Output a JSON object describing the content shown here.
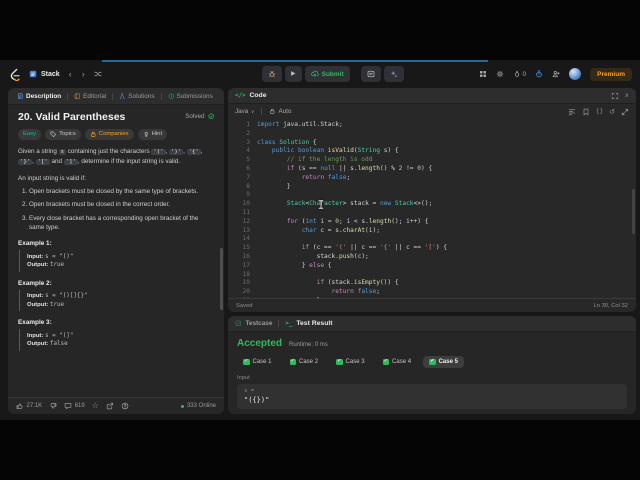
{
  "navbar": {
    "problem_list_label": "Stack",
    "submit_label": "Submit",
    "streak_count": "0",
    "premium_label": "Premium"
  },
  "description_panel": {
    "tabs": [
      {
        "label": "Description",
        "icon": "description",
        "active": true
      },
      {
        "label": "Editorial",
        "icon": "editorial",
        "active": false
      },
      {
        "label": "Solutions",
        "icon": "solutions",
        "active": false
      },
      {
        "label": "Submissions",
        "icon": "submissions",
        "active": false
      }
    ],
    "title": "20. Valid Parentheses",
    "solved_label": "Solved",
    "difficulty": "Easy",
    "topics_label": "Topics",
    "companies_label": "Companies",
    "hint_label": "Hint",
    "intro_segments": [
      {
        "t": "Given a string "
      },
      {
        "c": "s"
      },
      {
        "t": " containing just the characters "
      },
      {
        "c": "'('"
      },
      {
        "t": ", "
      },
      {
        "c": "')'"
      },
      {
        "t": ", "
      },
      {
        "c": "'{'"
      },
      {
        "t": ", "
      },
      {
        "c": "'}'"
      },
      {
        "t": ", "
      },
      {
        "c": "'['"
      },
      {
        "t": " and "
      },
      {
        "c": "']'"
      },
      {
        "t": ", determine if the input string is valid."
      }
    ],
    "valid_intro": "An input string is valid if:",
    "rules": [
      "Open brackets must be closed by the same type of brackets.",
      "Open brackets must be closed in the correct order.",
      "Every close bracket has a corresponding open bracket of the same type."
    ],
    "examples": [
      {
        "label": "Example 1:",
        "input_label": "Input:",
        "input_value": "s = \"()\"",
        "output_label": "Output:",
        "output_value": "true"
      },
      {
        "label": "Example 2:",
        "input_label": "Input:",
        "input_value": "s = \"()[]{}\"",
        "output_label": "Output:",
        "output_value": "true"
      },
      {
        "label": "Example 3:",
        "input_label": "Input:",
        "input_value": "s = \"(]\"",
        "output_label": "Output:",
        "output_value": "false"
      }
    ],
    "footer": {
      "likes": "27.1K",
      "comments": "619",
      "online_label": "333 Online"
    }
  },
  "code_panel": {
    "header_label": "Code",
    "language": "Java",
    "auto_label": "Auto",
    "status_saved": "Saved",
    "cursor_position": "Ln 30, Col 32",
    "code_lines": [
      [
        [
          "kw",
          "import"
        ],
        [
          "pl",
          " java.util.Stack;"
        ]
      ],
      [],
      [
        [
          "kw",
          "class"
        ],
        [
          "pl",
          " "
        ],
        [
          "ty",
          "Solution"
        ],
        [
          "pl",
          " {"
        ]
      ],
      [
        [
          "pl",
          "    "
        ],
        [
          "kw",
          "public boolean"
        ],
        [
          "pl",
          " "
        ],
        [
          "fn",
          "isValid"
        ],
        [
          "pl",
          "("
        ],
        [
          "ty",
          "String"
        ],
        [
          "pl",
          " s) {"
        ]
      ],
      [
        [
          "cm",
          "        // if the length is odd"
        ]
      ],
      [
        [
          "pl",
          "        "
        ],
        [
          "ct",
          "if"
        ],
        [
          "pl",
          " (s == "
        ],
        [
          "kw",
          "null"
        ],
        [
          "pl",
          " || s."
        ],
        [
          "fn",
          "length"
        ],
        [
          "pl",
          "() % "
        ],
        [
          "nu",
          "2"
        ],
        [
          "pl",
          " != "
        ],
        [
          "nu",
          "0"
        ],
        [
          "pl",
          ") {"
        ]
      ],
      [
        [
          "pl",
          "            "
        ],
        [
          "ct",
          "return"
        ],
        [
          "pl",
          " "
        ],
        [
          "kw",
          "false"
        ],
        [
          "pl",
          ";"
        ]
      ],
      [
        [
          "pl",
          "        }"
        ]
      ],
      [],
      [
        [
          "pl",
          "        "
        ],
        [
          "ty",
          "Stack"
        ],
        [
          "pl",
          "<"
        ],
        [
          "ty",
          "Character"
        ],
        [
          "pl",
          "> stack = "
        ],
        [
          "kw",
          "new"
        ],
        [
          "pl",
          " "
        ],
        [
          "ty",
          "Stack"
        ],
        [
          "pl",
          "<>();"
        ]
      ],
      [],
      [
        [
          "pl",
          "        "
        ],
        [
          "ct",
          "for"
        ],
        [
          "pl",
          " ("
        ],
        [
          "kw",
          "int"
        ],
        [
          "pl",
          " i = "
        ],
        [
          "nu",
          "0"
        ],
        [
          "pl",
          "; i < s."
        ],
        [
          "fn",
          "length"
        ],
        [
          "pl",
          "(); i++) {"
        ]
      ],
      [
        [
          "pl",
          "            "
        ],
        [
          "kw",
          "char"
        ],
        [
          "pl",
          " c = s."
        ],
        [
          "fn",
          "charAt"
        ],
        [
          "pl",
          "(i);"
        ]
      ],
      [],
      [
        [
          "pl",
          "            "
        ],
        [
          "ct",
          "if"
        ],
        [
          "pl",
          " (c == "
        ],
        [
          "st",
          "'('"
        ],
        [
          "pl",
          " || c == "
        ],
        [
          "st",
          "'{'"
        ],
        [
          "pl",
          " || c == "
        ],
        [
          "st",
          "'['"
        ],
        [
          "pl",
          ") {"
        ]
      ],
      [
        [
          "pl",
          "                stack."
        ],
        [
          "fn",
          "push"
        ],
        [
          "pl",
          "(c);"
        ]
      ],
      [
        [
          "pl",
          "            } "
        ],
        [
          "ct",
          "else"
        ],
        [
          "pl",
          " {"
        ]
      ],
      [],
      [
        [
          "pl",
          "                "
        ],
        [
          "ct",
          "if"
        ],
        [
          "pl",
          " (stack."
        ],
        [
          "fn",
          "isEmpty"
        ],
        [
          "pl",
          "()) {"
        ]
      ],
      [
        [
          "pl",
          "                    "
        ],
        [
          "ct",
          "return"
        ],
        [
          "pl",
          " "
        ],
        [
          "kw",
          "false"
        ],
        [
          "pl",
          ";"
        ]
      ],
      [
        [
          "pl",
          "                }"
        ]
      ]
    ]
  },
  "console_panel": {
    "testcase_tab": "Testcase",
    "result_tab": "Test Result",
    "status": "Accepted",
    "runtime": "Runtime: 0 ms",
    "cases": [
      "Case 1",
      "Case 2",
      "Case 3",
      "Case 4",
      "Case 5"
    ],
    "active_case_index": 4,
    "input_label": "Input",
    "input_var": "s =",
    "input_value": "\"({})\""
  },
  "icons": {
    "play": "▶",
    "chevron_left": "‹",
    "chevron_right": "›",
    "caret_down": "∨",
    "collapse": "∧",
    "star": "☆",
    "undo": "↺",
    "check": "✓",
    "code_tag": "</>",
    "terminal": ">_",
    "braces": "{}",
    "help": "?"
  }
}
